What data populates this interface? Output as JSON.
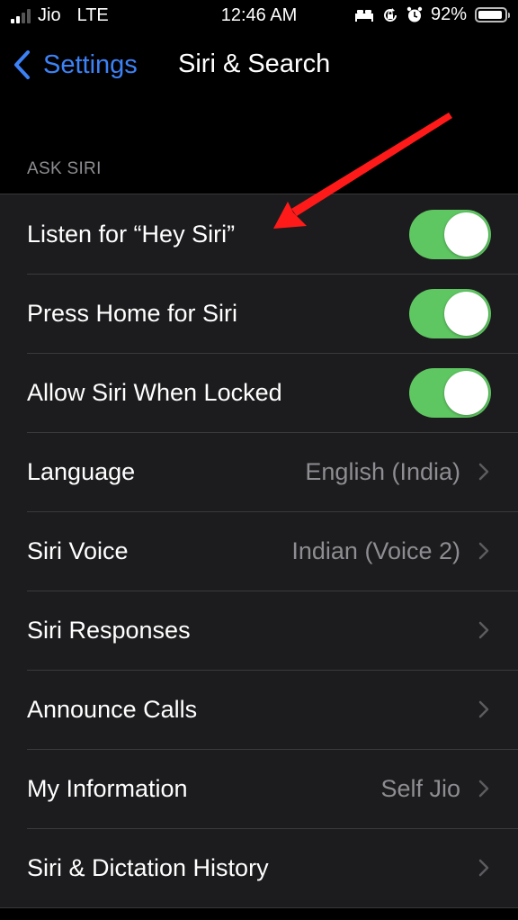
{
  "status_bar": {
    "carrier": "Jio",
    "network": "LTE",
    "time": "12:46 AM",
    "battery": "92%",
    "battery_level": 0.92,
    "signal_bars_active": 2,
    "signal_bars_total": 4,
    "icons": [
      "bed-icon",
      "rotation-lock-icon",
      "alarm-icon",
      "battery-icon"
    ]
  },
  "nav": {
    "back_label": "Settings",
    "title": "Siri & Search"
  },
  "section": {
    "header": "ASK SIRI"
  },
  "rows": [
    {
      "label": "Listen for “Hey Siri”",
      "type": "toggle",
      "on": true
    },
    {
      "label": "Press Home for Siri",
      "type": "toggle",
      "on": true
    },
    {
      "label": "Allow Siri When Locked",
      "type": "toggle",
      "on": true
    },
    {
      "label": "Language",
      "type": "link",
      "value": "English (India)"
    },
    {
      "label": "Siri Voice",
      "type": "link",
      "value": "Indian (Voice 2)"
    },
    {
      "label": "Siri Responses",
      "type": "link",
      "value": ""
    },
    {
      "label": "Announce Calls",
      "type": "link",
      "value": ""
    },
    {
      "label": "My Information",
      "type": "link",
      "value": "Self Jio"
    },
    {
      "label": "Siri & Dictation History",
      "type": "link",
      "value": ""
    }
  ],
  "colors": {
    "accent": "#3c82f6",
    "toggle_on": "#5fc762",
    "annotation_arrow": "#ff1a1a",
    "cell_background": "#1c1c1e",
    "secondary_text": "#8d8d92"
  },
  "annotation": {
    "type": "arrow",
    "points_to": "Listen for “Hey Siri”"
  }
}
